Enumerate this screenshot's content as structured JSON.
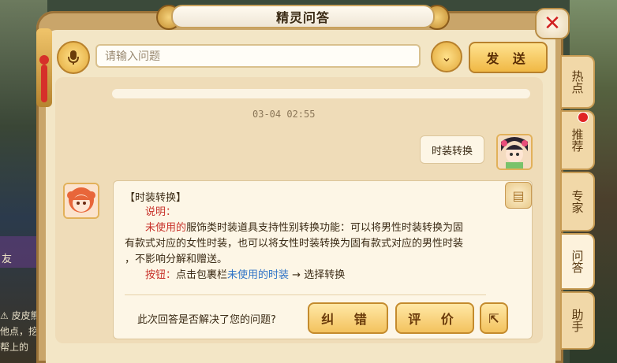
{
  "window": {
    "title": "精灵问答"
  },
  "input": {
    "placeholder": "请输入问题"
  },
  "buttons": {
    "send": "发 送",
    "fix": "纠 错",
    "rate": "评 价"
  },
  "chat": {
    "timestamp": "03-04  02:55",
    "user_message": "时装转换",
    "answer": {
      "title": "【时装转换】",
      "label_desc": "说明：",
      "desc_red": "未使用的",
      "desc_line1": "服饰类时装道具支持性别转换功能：可以将男性时装转换为固",
      "desc_line2": "有款式对应的女性时装，也可以将女性时装转换为固有款式对应的男性时装",
      "desc_line3": "，不影响分解和赠送。",
      "label_button": "按钮：",
      "btn_text_prefix": "点击包裹栏",
      "btn_text_blue": "未使用的时装",
      "btn_text_suffix": " → 选择转换"
    },
    "question": "此次回答是否解决了您的问题?"
  },
  "tabs": [
    {
      "label": "热点"
    },
    {
      "label": "推荐"
    },
    {
      "label": "专家"
    },
    {
      "label": "问答"
    },
    {
      "label": "助手"
    }
  ],
  "background_chat": {
    "line1": "⚠ 皮皮熊",
    "line2": "他点，挖",
    "line3": "帮上的",
    "line4": "友"
  },
  "icons": {
    "mic": "microphone-icon",
    "dropdown": "chevron-down-icon",
    "close": "close-icon",
    "share": "share-icon",
    "book": "book-icon"
  }
}
